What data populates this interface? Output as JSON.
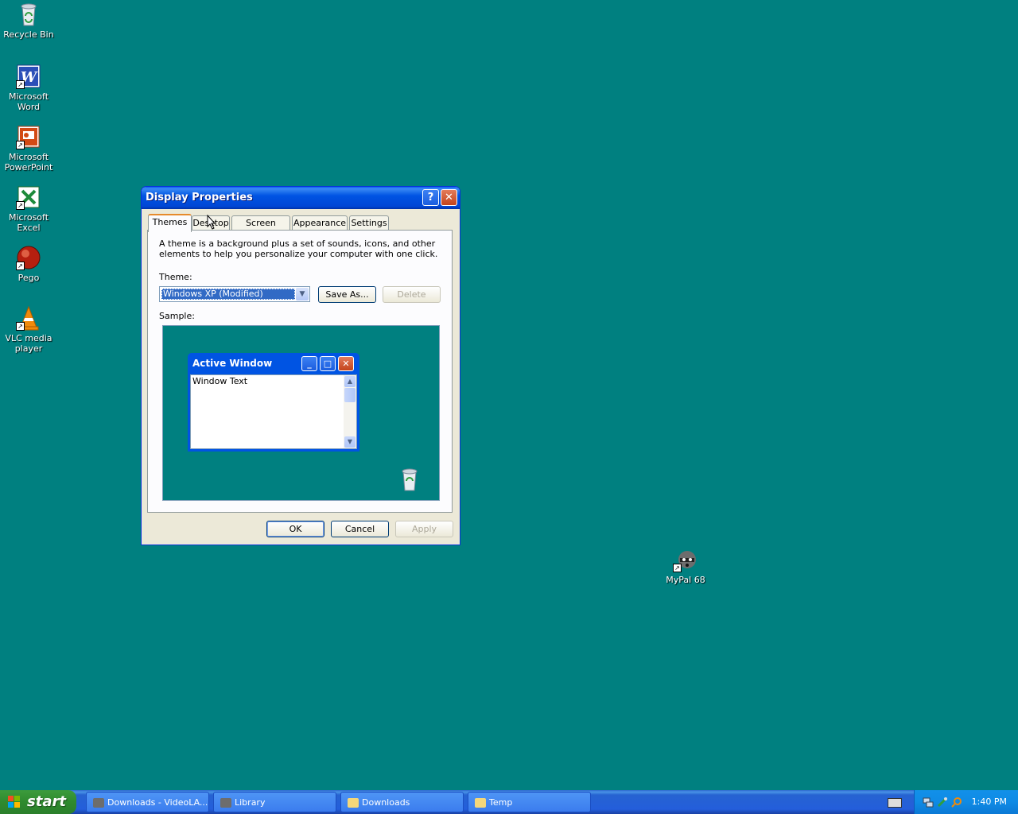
{
  "desktop": {
    "icons": [
      {
        "label": "Recycle Bin"
      },
      {
        "label": "Microsoft Word"
      },
      {
        "label": "Microsoft PowerPoint"
      },
      {
        "label": "Microsoft Excel"
      },
      {
        "label": "Pego"
      },
      {
        "label": "VLC media player"
      },
      {
        "label": "MyPal 68"
      }
    ]
  },
  "dialog": {
    "title": "Display Properties",
    "tabs": [
      "Themes",
      "Desktop",
      "Screen Saver",
      "Appearance",
      "Settings"
    ],
    "active_tab": "Themes",
    "description": "A theme is a background plus a set of sounds, icons, and other elements to help you personalize your computer with one click.",
    "theme_label": "Theme:",
    "theme_value": "Windows XP (Modified)",
    "save_as_label": "Save As...",
    "delete_label": "Delete",
    "sample_label": "Sample:",
    "sample": {
      "window_title": "Active Window",
      "window_text": "Window Text"
    },
    "ok_label": "OK",
    "cancel_label": "Cancel",
    "apply_label": "Apply"
  },
  "taskbar": {
    "start_label": "start",
    "tasks": [
      "Downloads - VideoLA...",
      "Library",
      "Downloads",
      "Temp"
    ],
    "clock": "1:40 PM"
  },
  "colors": {
    "desktop": "#008080",
    "titlebar": "#0054e3",
    "taskbar": "#245edb",
    "start": "#2f8a2f"
  }
}
